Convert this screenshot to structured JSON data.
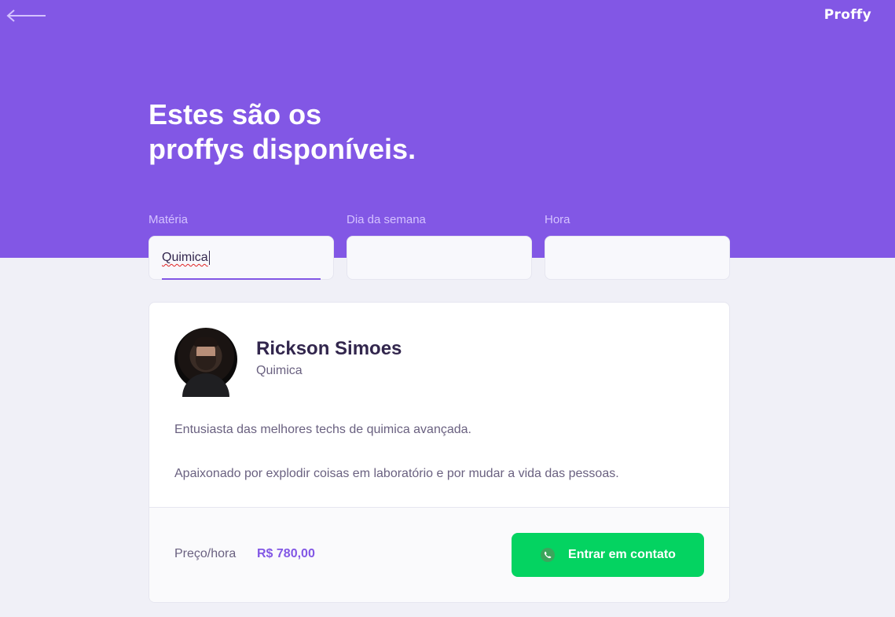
{
  "header": {
    "logo": "Proffy",
    "title_line1": "Estes são os",
    "title_line2": "proffys disponíveis."
  },
  "filters": {
    "subject": {
      "label": "Matéria",
      "value": "Quimica"
    },
    "weekday": {
      "label": "Dia da semana",
      "value": ""
    },
    "time": {
      "label": "Hora",
      "value": ""
    }
  },
  "teacher": {
    "name": "Rickson Simoes",
    "subject": "Quimica",
    "bio_paragraphs": [
      "Entusiasta das melhores techs de quimica avançada.",
      "Apaixonado por explodir coisas em laboratório e por mudar a vida das pessoas."
    ],
    "price_label": "Preço/hora",
    "price_value": "R$ 780,00",
    "contact_label": "Entrar em contato"
  },
  "icons": {
    "back": "arrow-left-icon",
    "contact": "whatsapp-icon"
  },
  "colors": {
    "primary": "#8257E5",
    "background": "#F0F0F7",
    "accent_green": "#04D361",
    "title_text": "#32264D",
    "body_text": "#6A6180"
  }
}
